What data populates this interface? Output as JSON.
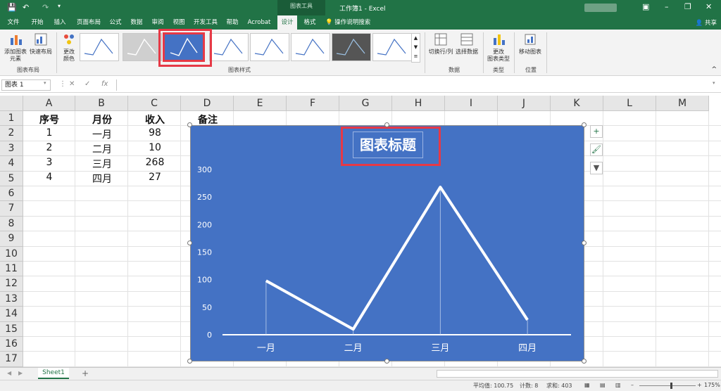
{
  "titlebar": {
    "context_tools": "图表工具",
    "window_title": "工作簿1 - Excel",
    "save_icon": "save-icon",
    "undo_icon": "undo-icon",
    "redo_icon": "redo-icon"
  },
  "tabs": [
    {
      "label": "文件"
    },
    {
      "label": "开始"
    },
    {
      "label": "插入"
    },
    {
      "label": "页面布局"
    },
    {
      "label": "公式"
    },
    {
      "label": "数据"
    },
    {
      "label": "审阅"
    },
    {
      "label": "视图"
    },
    {
      "label": "开发工具"
    },
    {
      "label": "帮助"
    },
    {
      "label": "Acrobat"
    },
    {
      "label": "设计"
    },
    {
      "label": "格式"
    }
  ],
  "tell_me": "操作说明搜索",
  "share": "共享",
  "ribbon": {
    "add_element": "添加图表",
    "add_element2": "元素",
    "quick_layout": "快速布局",
    "group_layout": "图表布局",
    "change_color": "更改",
    "change_color2": "颜色",
    "group_styles": "图表样式",
    "switch_rowcol": "切换行/列",
    "select_data": "选择数据",
    "group_data": "数据",
    "change_type": "更改",
    "change_type2": "图表类型",
    "group_type": "类型",
    "move_chart": "移动图表",
    "group_location": "位置"
  },
  "formula_bar": {
    "name_box": "图表 1",
    "fx": "fx",
    "value": ""
  },
  "columns": [
    "A",
    "B",
    "C",
    "D",
    "E",
    "F",
    "G",
    "H",
    "I",
    "J",
    "K",
    "L",
    "M"
  ],
  "rows": [
    "1",
    "2",
    "3",
    "4",
    "5",
    "6",
    "7",
    "8",
    "9",
    "10",
    "11",
    "12",
    "13",
    "14",
    "15",
    "16",
    "17"
  ],
  "cells": {
    "headers": [
      "序号",
      "月份",
      "收入",
      "备注"
    ],
    "data": [
      [
        "1",
        "一月",
        "98"
      ],
      [
        "2",
        "二月",
        "10"
      ],
      [
        "3",
        "三月",
        "268"
      ],
      [
        "4",
        "四月",
        "27"
      ]
    ]
  },
  "chart_data": {
    "type": "line",
    "title": "图表标题",
    "categories": [
      "一月",
      "二月",
      "三月",
      "四月"
    ],
    "values": [
      98,
      10,
      268,
      27
    ],
    "ylim": [
      0,
      300
    ],
    "yticks": [
      "0",
      "50",
      "100",
      "150",
      "200",
      "250",
      "300"
    ],
    "xlabel": "",
    "ylabel": "",
    "background": "#4472c4",
    "line_color": "#ffffff",
    "grid": false
  },
  "sheet": {
    "name": "Sheet1",
    "add": "+"
  },
  "status": {
    "average": "平均值: 100.75",
    "count": "计数: 8",
    "sum": "求和: 403",
    "zoom": "175%"
  },
  "colors": {
    "excel_green": "#217346",
    "highlight": "#e63946"
  }
}
